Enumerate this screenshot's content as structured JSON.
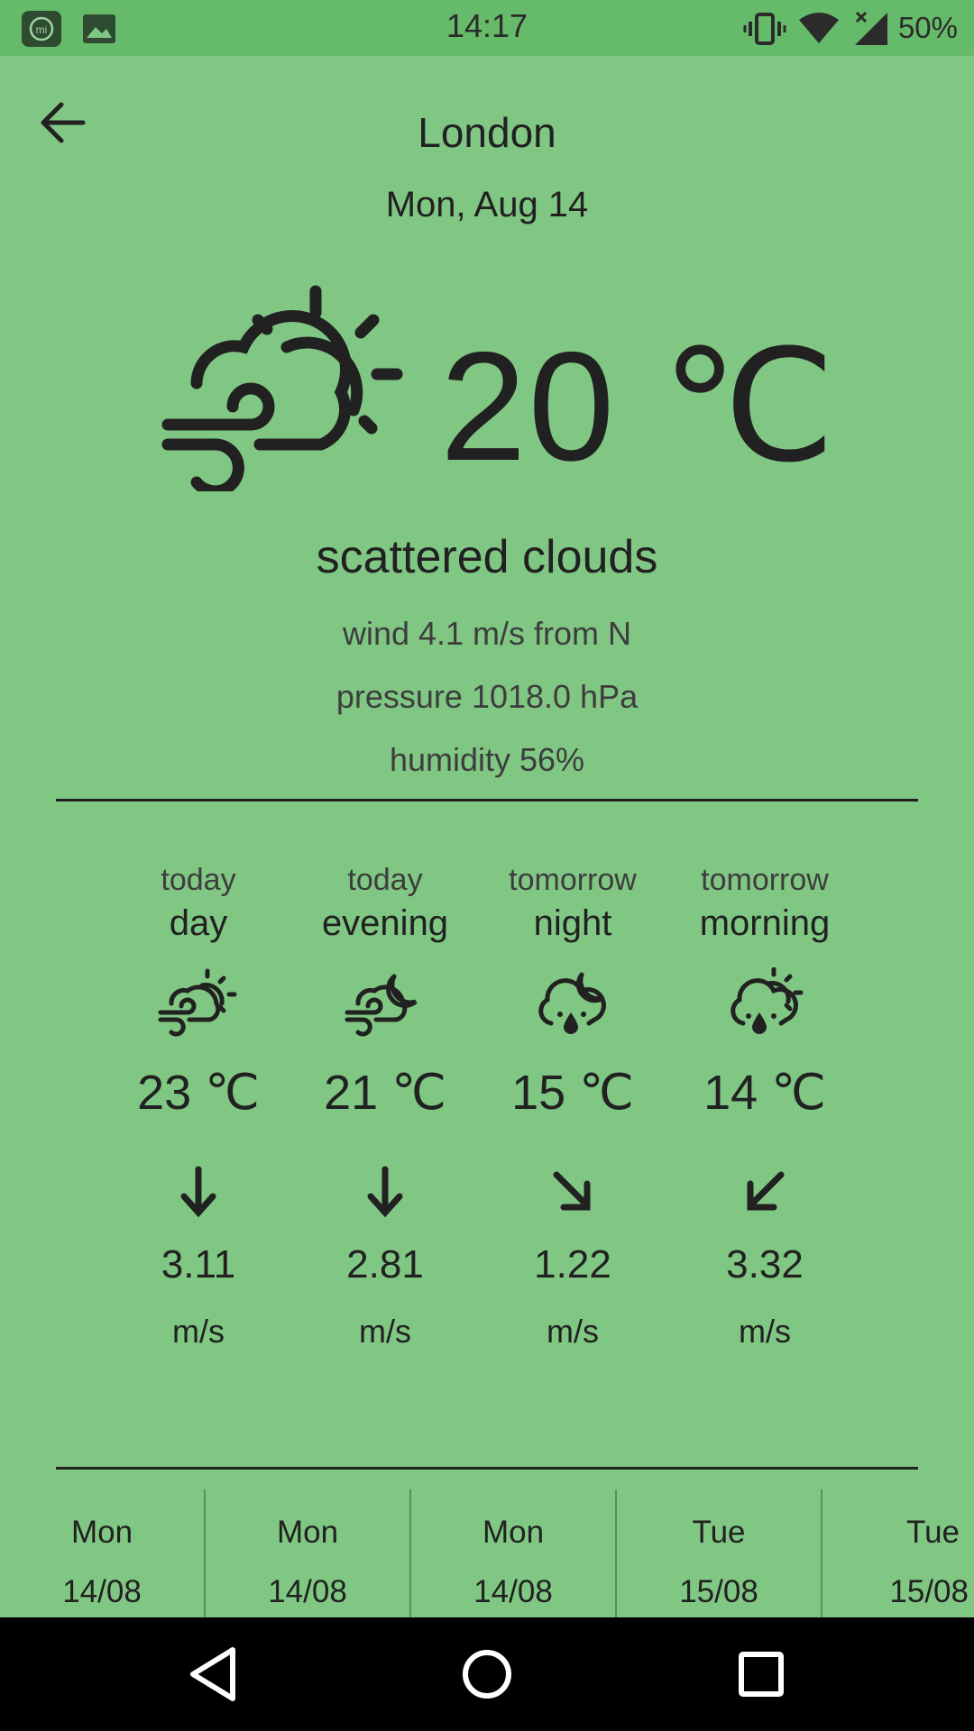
{
  "status_bar": {
    "time": "14:17",
    "battery": "50%",
    "icons": [
      "mi-app-icon",
      "gallery-icon",
      "vibrate-icon",
      "wifi-icon",
      "no-signal-icon"
    ]
  },
  "header": {
    "city": "London",
    "date": "Mon, Aug 14"
  },
  "current": {
    "icon": "windy-partly-cloudy-icon",
    "temperature": "20 ℃",
    "description": "scattered clouds",
    "wind": "wind 4.1 m/s from N",
    "pressure": "pressure 1018.0 hPa",
    "humidity": "humidity 56%"
  },
  "forecast": [
    {
      "when": "today",
      "part": "day",
      "icon": "windy-sun-cloud-icon",
      "temp": "23 ℃",
      "wind_dir": "down-arrow",
      "speed": "3.11",
      "unit": "m/s"
    },
    {
      "when": "today",
      "part": "evening",
      "icon": "windy-moon-cloud-icon",
      "temp": "21 ℃",
      "wind_dir": "down-arrow",
      "speed": "2.81",
      "unit": "m/s"
    },
    {
      "when": "tomorrow",
      "part": "night",
      "icon": "rain-moon-cloud-icon",
      "temp": "15 ℃",
      "wind_dir": "down-right-arrow",
      "speed": "1.22",
      "unit": "m/s"
    },
    {
      "when": "tomorrow",
      "part": "morning",
      "icon": "rain-sun-cloud-icon",
      "temp": "14 ℃",
      "wind_dir": "down-left-arrow",
      "speed": "3.32",
      "unit": "m/s"
    }
  ],
  "strip": [
    {
      "day": "Mon",
      "date": "14/08"
    },
    {
      "day": "Mon",
      "date": "14/08"
    },
    {
      "day": "Mon",
      "date": "14/08"
    },
    {
      "day": "Tue",
      "date": "15/08"
    },
    {
      "day": "Tue",
      "date": "15/08"
    }
  ],
  "colors": {
    "background": "#81C784",
    "status_bar": "#66BB6A",
    "text": "#212121",
    "nav_bar": "#000000"
  }
}
